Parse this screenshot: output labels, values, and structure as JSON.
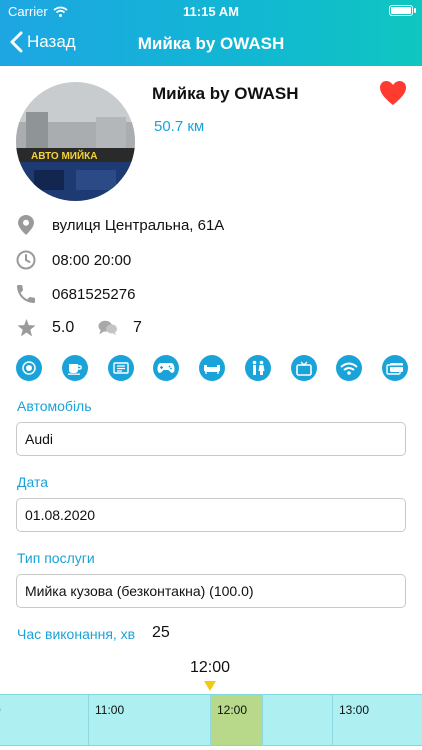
{
  "status_bar": {
    "carrier": "Carrier",
    "time": "11:15 AM"
  },
  "nav": {
    "back_label": "Назад",
    "title": "Мийка by OWASH"
  },
  "profile": {
    "name": "Мийка by OWASH",
    "distance": "50.7 км",
    "address": "вулиця Центральна, 61А",
    "hours": "08:00 20:00",
    "phone": "0681525276",
    "rating": "5.0",
    "comments": "7",
    "photo_sign": "АВТО МИЙКА"
  },
  "amenities": [
    "restaurant-icon",
    "coffee-icon",
    "vending-icon",
    "gamepad-icon",
    "lounge-icon",
    "restroom-icon",
    "tv-icon",
    "wifi-icon",
    "card-payment-icon"
  ],
  "form": {
    "car_label": "Автомобіль",
    "car_value": "Audi",
    "date_label": "Дата",
    "date_value": "01.08.2020",
    "service_label": "Тип послуги",
    "service_value": "Мийка кузова (безконтакна) (100.0)",
    "duration_label": "Час виконання, хв",
    "duration_value": "25"
  },
  "timeline": {
    "current": "12:00",
    "slots": [
      "0",
      "11:00",
      "12:00",
      "",
      "13:00"
    ]
  },
  "colors": {
    "accent": "#1aa3d8",
    "heart": "#ff3b30",
    "marker": "#f2c811",
    "slot_selected": "#b8d98a",
    "timeline_bg": "#aef0f2"
  }
}
